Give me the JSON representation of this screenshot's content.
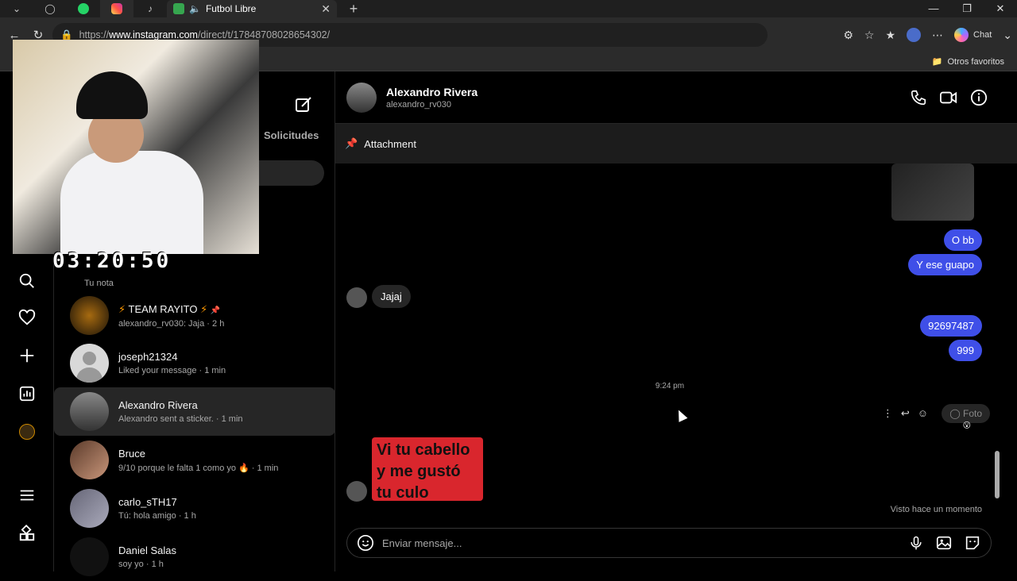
{
  "browser": {
    "tab_title": "Futbol Libre",
    "url_prefix": "https://",
    "url_domain": "www.instagram.com",
    "url_path": "/direct/t/17848708028654302/",
    "chat_label": "Chat",
    "favorites_label": "Otros favoritos"
  },
  "webcam": {
    "timer": "03:20:50"
  },
  "inbox": {
    "requests_label": "Solicitudes",
    "your_note": "Tu nota",
    "conversations": [
      {
        "name": "TEAM RAYITO",
        "sub": "alexandro_rv030: Jaja · 2 h"
      },
      {
        "name": "joseph21324",
        "sub": "Liked your message · 1 min"
      },
      {
        "name": "Alexandro Rivera",
        "sub": "Alexandro sent a sticker. · 1 min"
      },
      {
        "name": "Bruce",
        "sub": "9/10 porque le falta 1 como yo 🔥 · 1 min"
      },
      {
        "name": "carlo_sTH17",
        "sub": "Tú: hola amigo · 1 h"
      },
      {
        "name": "Daniel Salas",
        "sub": "soy yo · 1 h"
      }
    ]
  },
  "chat": {
    "name": "Alexandro Rivera",
    "username": "alexandro_rv030",
    "pinned_label": "Attachment",
    "messages_out_1": [
      "O bb",
      "Y ese guapo"
    ],
    "message_in_1": "Jajaj",
    "messages_out_2": [
      "92697487",
      "999"
    ],
    "timestamp": "9:24 pm",
    "foto_label": "Foto",
    "sticker_text": [
      "Vi tu cabello",
      "y me gustó",
      "tu culo"
    ],
    "seen_label": "Visto hace un momento",
    "input_placeholder": "Enviar mensaje..."
  }
}
